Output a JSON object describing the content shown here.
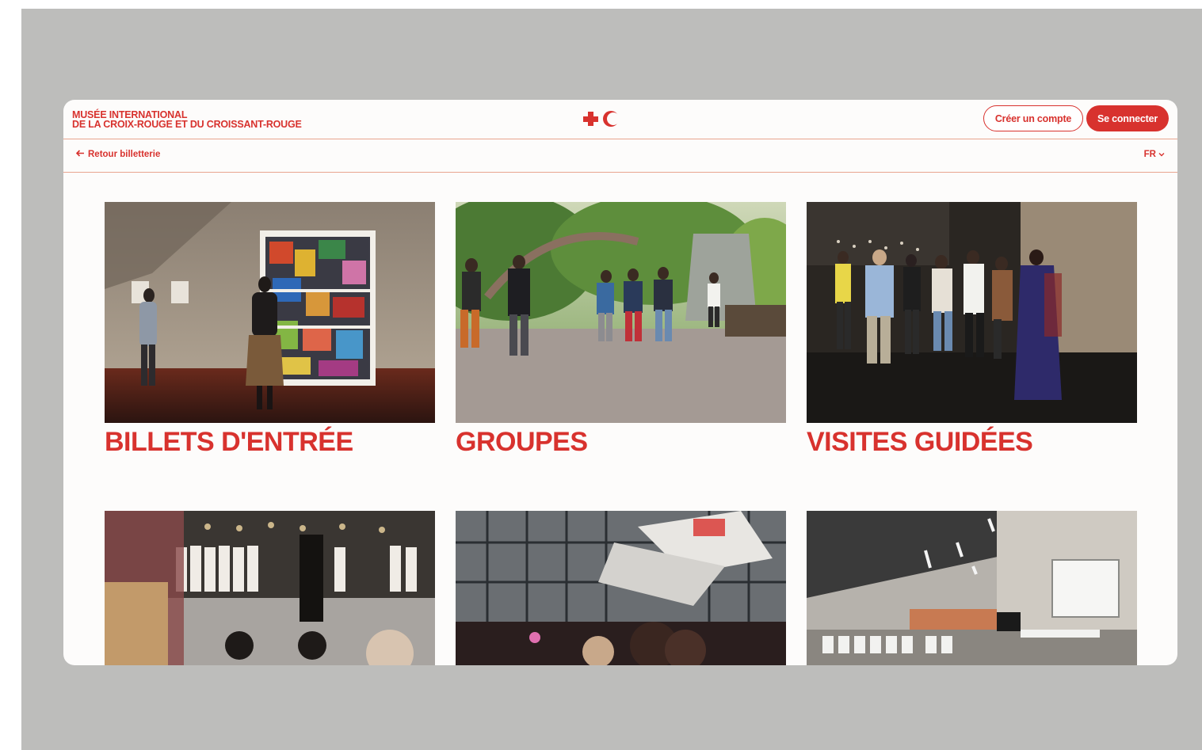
{
  "header": {
    "museum_line1": "MUSÉE INTERNATIONAL",
    "museum_line2": "DE LA CROIX-ROUGE ET DU CROISSANT-ROUGE",
    "logo_icon": "red-cross-crescent-logo",
    "create_account_label": "Créer un compte",
    "login_label": "Se connecter"
  },
  "subnav": {
    "back_label": "Retour billetterie",
    "back_icon": "arrow-left-icon",
    "language": "FR",
    "language_icon": "chevron-down-icon"
  },
  "cards": [
    {
      "title": "BILLETS D'ENTRÉE"
    },
    {
      "title": "GROUPES"
    },
    {
      "title": "VISITES GUIDÉES"
    },
    {
      "title": ""
    },
    {
      "title": ""
    },
    {
      "title": ""
    }
  ],
  "colors": {
    "brand_red": "#d8322e",
    "backdrop": "#bdbdbb",
    "page_bg": "#fdfcfb"
  }
}
